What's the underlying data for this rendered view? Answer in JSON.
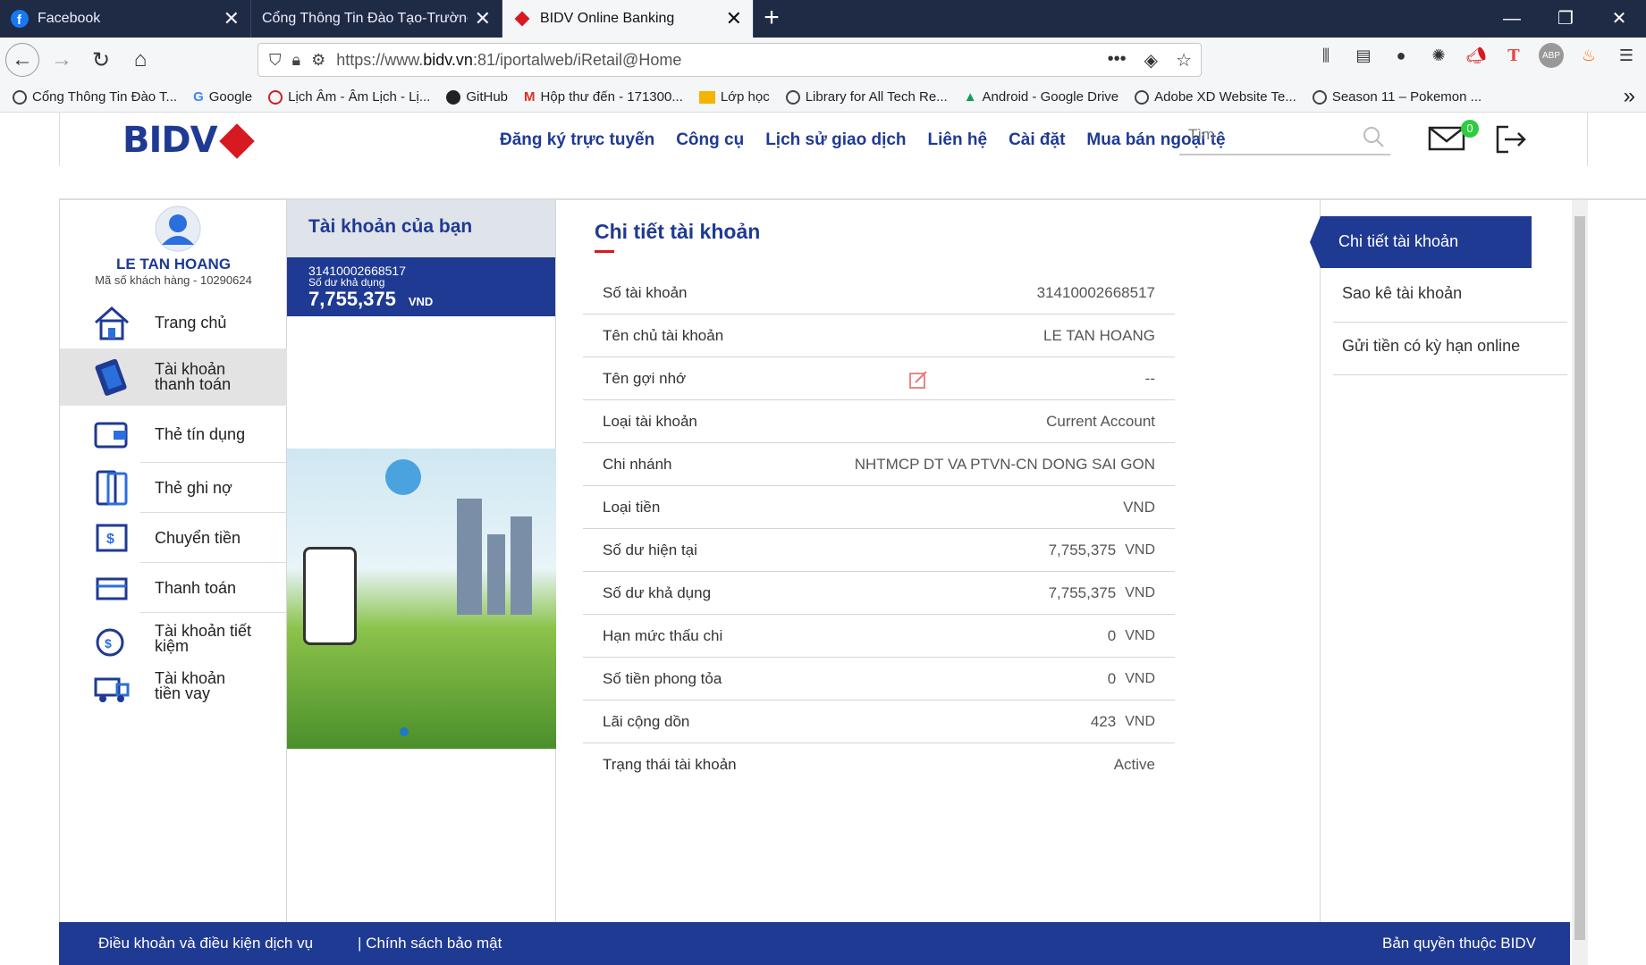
{
  "browser": {
    "tabs": [
      {
        "title": "Facebook",
        "icon": "facebook-icon"
      },
      {
        "title": "Cổng Thông Tin Đào Tạo-Trường Đ",
        "icon": "globe-icon"
      },
      {
        "title": "BIDV Online Banking",
        "icon": "bidv-icon"
      }
    ],
    "url_prefix": "https://www.",
    "url_domain": "bidv.vn",
    "url_rest": ":81/iportalweb/iRetail@Home",
    "bookmarks": [
      "Cổng Thông Tin Đào T...",
      "Google",
      "Lịch Âm - Âm Lịch - Lị...",
      "GitHub",
      "Hộp thư đến - 171300...",
      "Lớp học",
      "Library for All Tech Re...",
      "Android - Google Drive",
      "Adobe XD Website Te...",
      "Season 11 – Pokemon ..."
    ]
  },
  "header": {
    "logo": "BIDV",
    "menu": [
      "Đăng ký trực tuyến",
      "Công cụ",
      "Lịch sử giao dịch",
      "Liên hệ",
      "Cài đặt",
      "Mua bán ngoại tệ"
    ],
    "search_placeholder": "Tìm",
    "mail_count": "0"
  },
  "user": {
    "name": "LE TAN HOANG",
    "code": "Mã số khách hàng - 10290624"
  },
  "sidebar": {
    "items": [
      {
        "label": "Trang chủ",
        "icon": "home-icon"
      },
      {
        "label": "Tài khoản thanh toán",
        "icon": "card-account-icon"
      },
      {
        "label": "Thẻ tín dụng",
        "icon": "wallet-icon"
      },
      {
        "label": "Thẻ ghi nợ",
        "icon": "debit-card-icon"
      },
      {
        "label": "Chuyển tiền",
        "icon": "transfer-icon"
      },
      {
        "label": "Thanh toán",
        "icon": "payment-icon"
      },
      {
        "label": "Tài khoản tiết kiệm",
        "icon": "savings-icon"
      },
      {
        "label": "Tài khoản tiền vay",
        "icon": "loan-icon"
      }
    ]
  },
  "accounts": {
    "heading": "Tài khoản của bạn",
    "card_number": "31410002668517",
    "card_label": "Số dư khả dụng",
    "card_balance": "7,755,375",
    "card_currency": "VND"
  },
  "detail": {
    "title": "Chi tiết tài khoản",
    "rows": [
      {
        "k": "Số tài khoản",
        "v": "31410002668517",
        "u": ""
      },
      {
        "k": "Tên chủ tài khoản",
        "v": "LE TAN HOANG",
        "u": ""
      },
      {
        "k": "Tên gợi nhớ",
        "v": "--",
        "u": ""
      },
      {
        "k": "Loại tài khoản",
        "v": "Current Account",
        "u": ""
      },
      {
        "k": "Chi nhánh",
        "v": "NHTMCP DT VA PTVN-CN DONG SAI GON",
        "u": ""
      },
      {
        "k": "Loại tiền",
        "v": "VND",
        "u": ""
      },
      {
        "k": "Số dư hiện tại",
        "v": "7,755,375",
        "u": "VND"
      },
      {
        "k": "Số dư khả dụng",
        "v": "7,755,375",
        "u": "VND"
      },
      {
        "k": "Hạn mức thấu chi",
        "v": "0",
        "u": "VND"
      },
      {
        "k": "Số tiền phong tỏa",
        "v": "0",
        "u": "VND"
      },
      {
        "k": "Lãi cộng dồn",
        "v": "423",
        "u": "VND"
      },
      {
        "k": "Trạng thái tài khoản",
        "v": "Active",
        "u": ""
      }
    ]
  },
  "right_menu": {
    "active": "Chi tiết tài khoản",
    "items": [
      "Sao kê tài khoản",
      "Gửi tiền có kỳ hạn online"
    ]
  },
  "footer": {
    "terms": "Điều khoản và điều kiện dịch vụ",
    "privacy": "| Chính sách bảo mật",
    "copyright": "Bản quyền thuộc BIDV"
  },
  "colors": {
    "brand": "#1f3a93",
    "accent": "#d71920",
    "badge": "#2ecc40"
  }
}
